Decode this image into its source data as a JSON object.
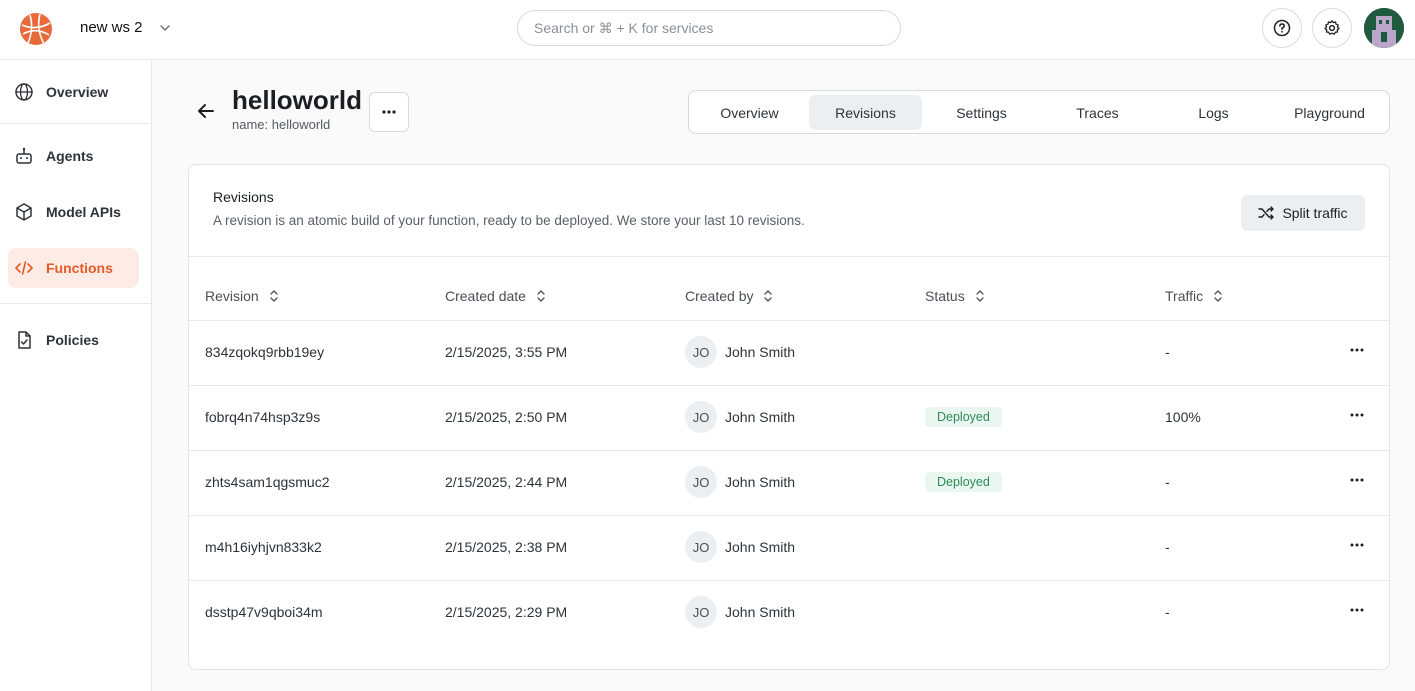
{
  "workspace": {
    "name": "new ws 2"
  },
  "search": {
    "placeholder": "Search or ⌘ + K for services"
  },
  "sidebar": {
    "items": [
      {
        "label": "Overview",
        "icon": "globe-icon"
      },
      {
        "label": "Agents",
        "icon": "robot-icon"
      },
      {
        "label": "Model APIs",
        "icon": "cube-icon"
      },
      {
        "label": "Functions",
        "icon": "code-icon",
        "active": true
      },
      {
        "label": "Policies",
        "icon": "document-icon"
      }
    ]
  },
  "function": {
    "title": "helloworld",
    "subtitle": "name: helloworld"
  },
  "tabs": [
    {
      "label": "Overview"
    },
    {
      "label": "Revisions",
      "active": true
    },
    {
      "label": "Settings"
    },
    {
      "label": "Traces"
    },
    {
      "label": "Logs"
    },
    {
      "label": "Playground"
    }
  ],
  "card": {
    "title": "Revisions",
    "description": "A revision is an atomic build of your function, ready to be deployed. We store your last 10 revisions.",
    "split_label": "Split traffic"
  },
  "table": {
    "columns": [
      "Revision",
      "Created date",
      "Created by",
      "Status",
      "Traffic"
    ],
    "rows": [
      {
        "revision": "834zqokq9rbb19ey",
        "created": "2/15/2025, 3:55 PM",
        "initials": "JO",
        "user": "John Smith",
        "status": "",
        "traffic": "-"
      },
      {
        "revision": "fobrq4n74hsp3z9s",
        "created": "2/15/2025, 2:50 PM",
        "initials": "JO",
        "user": "John Smith",
        "status": "Deployed",
        "traffic": "100%"
      },
      {
        "revision": "zhts4sam1qgsmuc2",
        "created": "2/15/2025, 2:44 PM",
        "initials": "JO",
        "user": "John Smith",
        "status": "Deployed",
        "traffic": "-"
      },
      {
        "revision": "m4h16iyhjvn833k2",
        "created": "2/15/2025, 2:38 PM",
        "initials": "JO",
        "user": "John Smith",
        "status": "",
        "traffic": "-"
      },
      {
        "revision": "dsstp47v9qboi34m",
        "created": "2/15/2025, 2:29 PM",
        "initials": "JO",
        "user": "John Smith",
        "status": "",
        "traffic": "-"
      }
    ]
  },
  "colors": {
    "accent": "#e65a28",
    "active_nav_bg": "#fdece6",
    "deployed_text": "#2e8a5a",
    "deployed_bg": "#eaf7f0"
  }
}
